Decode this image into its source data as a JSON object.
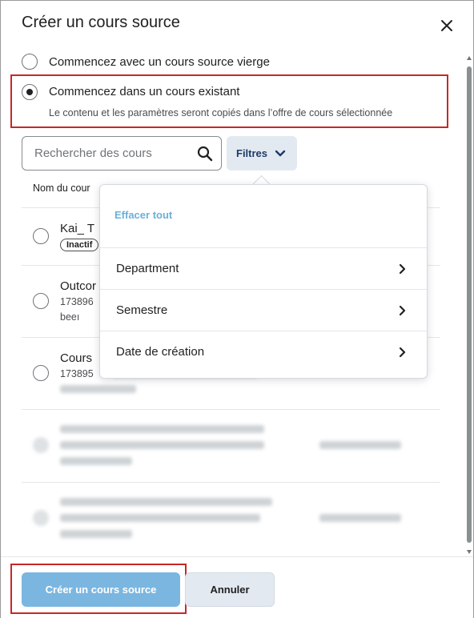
{
  "dialog": {
    "title": "Créer un cours source",
    "close_icon": "close-icon"
  },
  "options": [
    {
      "label": "Commencez avec un cours source vierge",
      "checked": false
    },
    {
      "label": "Commencez dans un cours existant",
      "checked": true,
      "description": "Le contenu et les paramètres seront copiés dans l’offre de cours sélectionnée"
    }
  ],
  "search": {
    "placeholder": "Rechercher des cours",
    "icon": "search-icon"
  },
  "filters": {
    "label": "Filtres",
    "icon": "chevron-down-icon"
  },
  "table": {
    "column_header": "Nom du cour",
    "rows": [
      {
        "title": "Kai_ T",
        "badge": "Inactif"
      },
      {
        "title": "Outcor",
        "sub1": "173896",
        "sub2": "beeı"
      },
      {
        "title": "Cours",
        "sub1": "173895"
      }
    ]
  },
  "filter_menu": {
    "clear_all": "Effacer tout",
    "items": [
      "Department",
      "Semestre",
      "Date de création"
    ]
  },
  "footer": {
    "primary": "Créer un cours source",
    "secondary": "Annuler"
  },
  "colors": {
    "highlight": "#c62828",
    "primary_button": "#7bb6e0",
    "link": "#6bb0d9"
  }
}
